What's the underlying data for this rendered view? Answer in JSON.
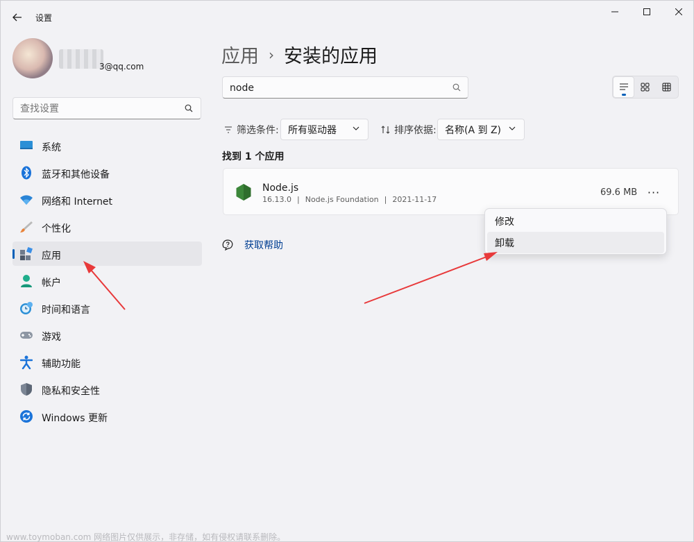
{
  "window": {
    "title": "设置",
    "controls": {
      "minimize": "minimize-icon",
      "maximize": "maximize-icon",
      "close": "close-icon"
    }
  },
  "profile": {
    "email": "3@qq.com"
  },
  "sidebar": {
    "search_placeholder": "查找设置",
    "items": [
      {
        "label": "系统",
        "icon": "system-icon"
      },
      {
        "label": "蓝牙和其他设备",
        "icon": "bluetooth-icon"
      },
      {
        "label": "网络和 Internet",
        "icon": "wifi-icon"
      },
      {
        "label": "个性化",
        "icon": "brush-icon"
      },
      {
        "label": "应用",
        "icon": "apps-icon",
        "active": true
      },
      {
        "label": "帐户",
        "icon": "account-icon"
      },
      {
        "label": "时间和语言",
        "icon": "time-language-icon"
      },
      {
        "label": "游戏",
        "icon": "gamepad-icon"
      },
      {
        "label": "辅助功能",
        "icon": "accessibility-icon"
      },
      {
        "label": "隐私和安全性",
        "icon": "shield-icon"
      },
      {
        "label": "Windows 更新",
        "icon": "update-icon"
      }
    ]
  },
  "main": {
    "breadcrumb": {
      "parent": "应用",
      "separator": "›",
      "current": "安装的应用"
    },
    "search_value": "node",
    "filter": {
      "label": "筛选条件:",
      "value": "所有驱动器"
    },
    "sort": {
      "label": "排序依据:",
      "value": "名称(A 到 Z)"
    },
    "found_text": "找到 1 个应用",
    "apps": [
      {
        "name": "Node.js",
        "version": "16.13.0",
        "publisher": "Node.js Foundation",
        "date": "2021-11-17",
        "separator": "|",
        "size": "69.6 MB",
        "more": "···"
      }
    ],
    "context_menu": {
      "items": [
        "修改",
        "卸载"
      ]
    },
    "help_label": "获取帮助"
  },
  "colors": {
    "accent": "#005fb8",
    "annotation_arrow": "#e8393a",
    "node_green": "#3c873a"
  },
  "watermark": "www.toymoban.com 网络图片仅供展示，非存储，如有侵权请联系删除。"
}
